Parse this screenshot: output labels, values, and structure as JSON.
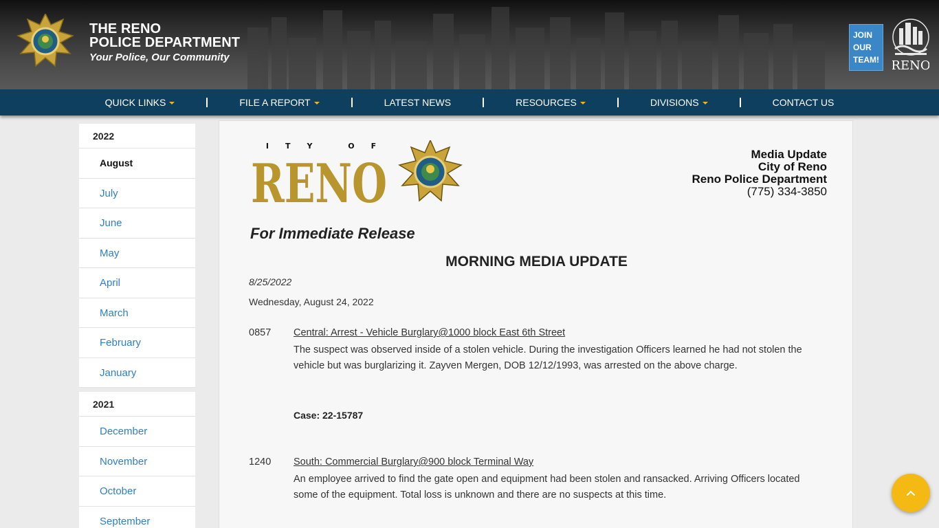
{
  "header": {
    "title_line1": "THE RENO",
    "title_line2": "POLICE DEPARTMENT",
    "tagline": "Your Police, Our Community",
    "join_button": [
      "JOIN",
      "OUR",
      "TEAM!"
    ],
    "badge_icon": "police-badge-icon",
    "city_logo_icon": "city-of-reno-logo"
  },
  "nav": {
    "items": [
      {
        "label": "QUICK LINKS",
        "dropdown": true
      },
      {
        "label": "FILE A REPORT",
        "dropdown": true
      },
      {
        "label": "LATEST NEWS",
        "dropdown": false
      },
      {
        "label": "RESOURCES",
        "dropdown": true
      },
      {
        "label": "DIVISIONS",
        "dropdown": true
      },
      {
        "label": "CONTACT US",
        "dropdown": false
      }
    ]
  },
  "sidebar": {
    "years": [
      {
        "year": "2022",
        "months": [
          "August",
          "July",
          "June",
          "May",
          "April",
          "March",
          "February",
          "January"
        ],
        "active": "August"
      },
      {
        "year": "2021",
        "months": [
          "December",
          "November",
          "October",
          "September"
        ]
      }
    ]
  },
  "content": {
    "logo_text": "RENO",
    "logo_top_text": "CITY OF",
    "media_box": {
      "line1": "Media Update",
      "line2": "City of Reno",
      "line3": "Reno Police Department",
      "phone": "(775) 334-3850"
    },
    "release": "For Immediate Release",
    "headline": "MORNING MEDIA UPDATE",
    "pub_date": "8/25/2022",
    "day_date": "Wednesday, August 24, 2022",
    "entries": [
      {
        "time": "0857",
        "title": "Central: Arrest - Vehicle Burglary@1000 block East 6th Street",
        "desc": "The suspect was observed inside of a stolen vehicle. During the investigation Officers learned he had not stolen the vehicle but was burglarizing it. Zayven Mergen, DOB 12/12/1993, was arrested on the above charge."
      },
      {
        "time": "1240",
        "title": "South: Commercial Burglary@900 block Terminal Way",
        "desc": "An employee arrived to find the gate open and equipment had been stolen and ransacked. Arriving Officers located some of the equipment. Total loss is unknown and there are no suspects at this time."
      }
    ],
    "case": "Case: 22-15787"
  },
  "colors": {
    "nav_bg": "#0e3f5e",
    "accent_gold": "#e9b627",
    "link_blue": "#2f7fc2",
    "join_blue": "#3a87c8",
    "scroll_button": "#f5b914"
  },
  "scroll_top_icon": "chevron-up-icon"
}
